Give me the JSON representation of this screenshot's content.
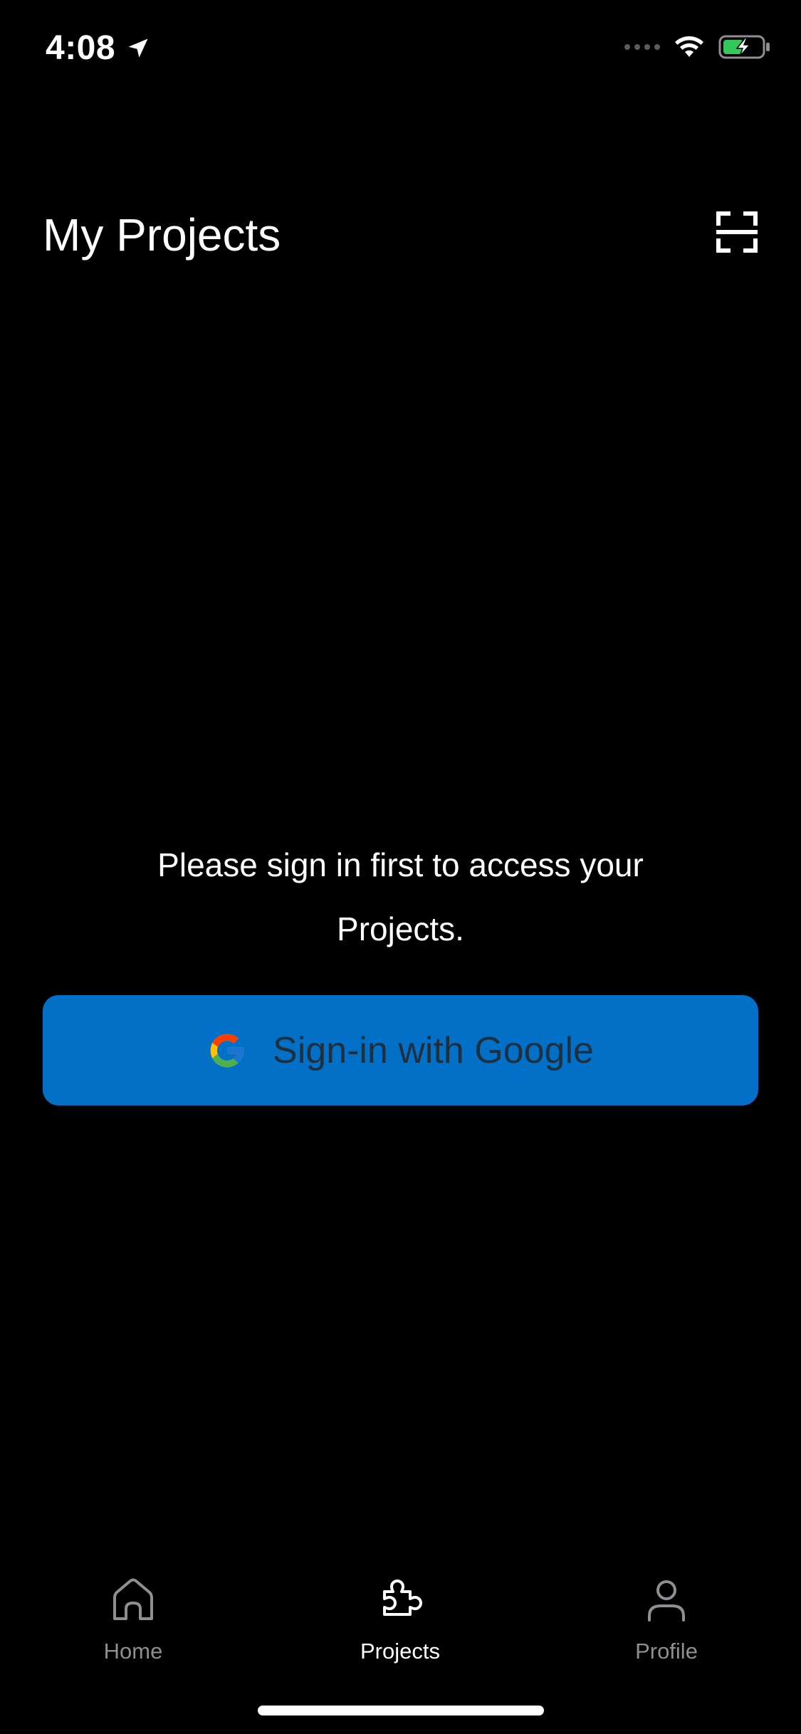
{
  "status_bar": {
    "time": "4:08",
    "location_icon": "location-arrow-icon",
    "wifi_icon": "wifi-icon",
    "battery_icon": "battery-charging-icon",
    "battery_color": "#34c759"
  },
  "header": {
    "title": "My Projects",
    "scan_icon": "scan-icon"
  },
  "main": {
    "message": "Please sign in first to access your Projects.",
    "google_button": {
      "label": "Sign-in with Google",
      "icon": "google-logo-icon",
      "background": "#0270c7"
    }
  },
  "tab_bar": {
    "active_tab": "Projects",
    "tabs": [
      {
        "label": "Home",
        "icon": "home-icon"
      },
      {
        "label": "Projects",
        "icon": "puzzle-icon"
      },
      {
        "label": "Profile",
        "icon": "person-icon"
      }
    ]
  }
}
